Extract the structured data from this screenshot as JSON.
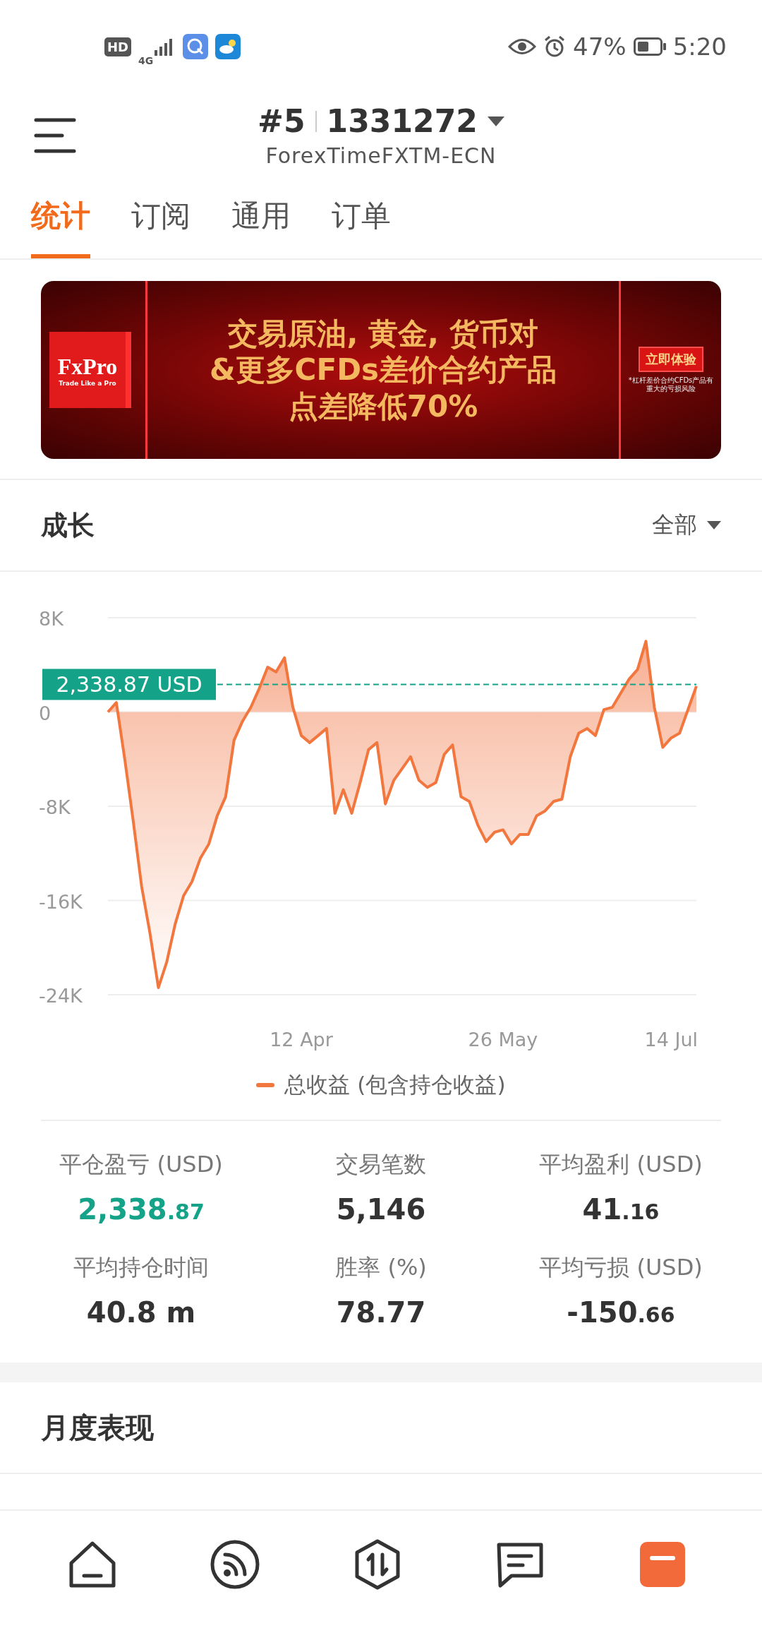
{
  "status_bar": {
    "badge": "HD",
    "network": "4G",
    "battery": "47%",
    "time": "5:20"
  },
  "header": {
    "account_prefix": "#5",
    "account_number": "1331272",
    "server": "ForexTimeFXTM-ECN"
  },
  "tabs": [
    {
      "label": "统计",
      "selected": true
    },
    {
      "label": "订阅",
      "selected": false
    },
    {
      "label": "通用",
      "selected": false
    },
    {
      "label": "订单",
      "selected": false
    }
  ],
  "banner": {
    "logo": "FxPro",
    "logo_tagline": "Trade Like a Pro",
    "lines": [
      "交易原油, 黄金, 货币对",
      "&更多CFDs差价合约产品",
      "点差降低70%"
    ],
    "cta": "立即体验",
    "disclaimer": "*杠杆差价合约CFDs产品有重大的亏损风险"
  },
  "growth": {
    "title": "成长",
    "filter": "全部",
    "chart_data": {
      "type": "area",
      "categories": [
        null,
        null,
        null,
        null,
        null,
        null,
        null,
        null,
        null,
        null,
        null,
        null,
        null,
        null,
        null,
        null,
        null,
        null,
        null,
        null,
        null,
        null,
        null,
        "12 Apr",
        null,
        null,
        null,
        null,
        null,
        null,
        null,
        null,
        null,
        null,
        null,
        null,
        null,
        null,
        null,
        null,
        null,
        null,
        null,
        null,
        null,
        null,
        null,
        "26 May",
        null,
        null,
        null,
        null,
        null,
        null,
        null,
        null,
        null,
        null,
        null,
        null,
        null,
        null,
        null,
        null,
        null,
        null,
        null,
        "14 Jul",
        null,
        null,
        null
      ],
      "series": [
        {
          "name": "总收益 (包含持仓收益)",
          "color": "#f2773f",
          "values": [
            0,
            800,
            -4000,
            -9200,
            -14800,
            -18800,
            -23400,
            -21200,
            -18000,
            -15600,
            -14400,
            -12400,
            -11200,
            -8800,
            -7200,
            -2400,
            -800,
            400,
            2000,
            3800,
            3400,
            4600,
            400,
            -2000,
            -2600,
            -2000,
            -1400,
            -8600,
            -6600,
            -8600,
            -6000,
            -3200,
            -2600,
            -7800,
            -5800,
            -4800,
            -3800,
            -5800,
            -6400,
            -6000,
            -3600,
            -2800,
            -7200,
            -7600,
            -9600,
            -11000,
            -10200,
            -10000,
            -11200,
            -10400,
            -10400,
            -8800,
            -8400,
            -7600,
            -7400,
            -3800,
            -1800,
            -1400,
            -2000,
            200,
            400,
            1600,
            2800,
            3600,
            6000,
            400,
            -3000,
            -2200,
            -1800,
            200,
            2200
          ]
        }
      ],
      "ylim": [
        -24000,
        8000
      ],
      "yticks": [
        {
          "value": 8000,
          "label": "8K"
        },
        {
          "value": 0,
          "label": "0"
        },
        {
          "value": -8000,
          "label": "-8K"
        },
        {
          "value": -16000,
          "label": "-16K"
        },
        {
          "value": -24000,
          "label": "-24K"
        }
      ],
      "grid": true,
      "ref_lines": [
        {
          "axis": "y",
          "value": 2338.87,
          "label": "2,338.87 USD"
        }
      ]
    }
  },
  "stats": [
    {
      "label": "平仓盈亏 (USD)",
      "value": "2,338",
      "fraction": ".87",
      "kind": "profit"
    },
    {
      "label": "交易笔数",
      "value": "5,146",
      "kind": "plain"
    },
    {
      "label": "平均盈利 (USD)",
      "value": "41",
      "fraction": ".16",
      "kind": "plain"
    },
    {
      "label": "平均持仓时间",
      "value": "40.8 m",
      "kind": "plain"
    },
    {
      "label": "胜率 (%)",
      "value": "78.77",
      "kind": "plain"
    },
    {
      "label": "平均亏损 (USD)",
      "value": "-150",
      "fraction": ".66",
      "kind": "plain"
    }
  ],
  "monthly": {
    "title": "月度表现"
  }
}
